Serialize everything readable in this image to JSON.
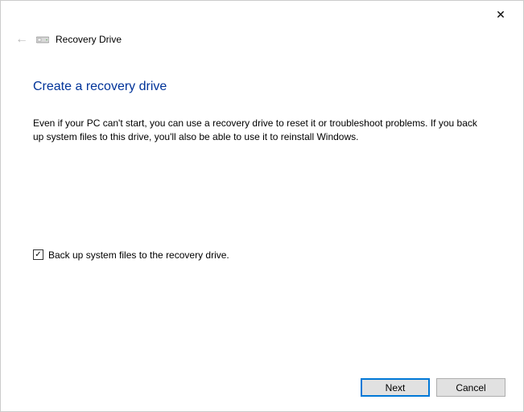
{
  "titlebar": {
    "close_glyph": "✕"
  },
  "header": {
    "back_glyph": "←",
    "window_title": "Recovery Drive"
  },
  "main": {
    "heading": "Create a recovery drive",
    "description": "Even if your PC can't start, you can use a recovery drive to reset it or troubleshoot problems. If you back up system files to this drive, you'll also be able to use it to reinstall Windows."
  },
  "checkbox": {
    "checked_glyph": "✓",
    "label": "Back up system files to the recovery drive."
  },
  "footer": {
    "next_label": "Next",
    "cancel_label": "Cancel"
  }
}
